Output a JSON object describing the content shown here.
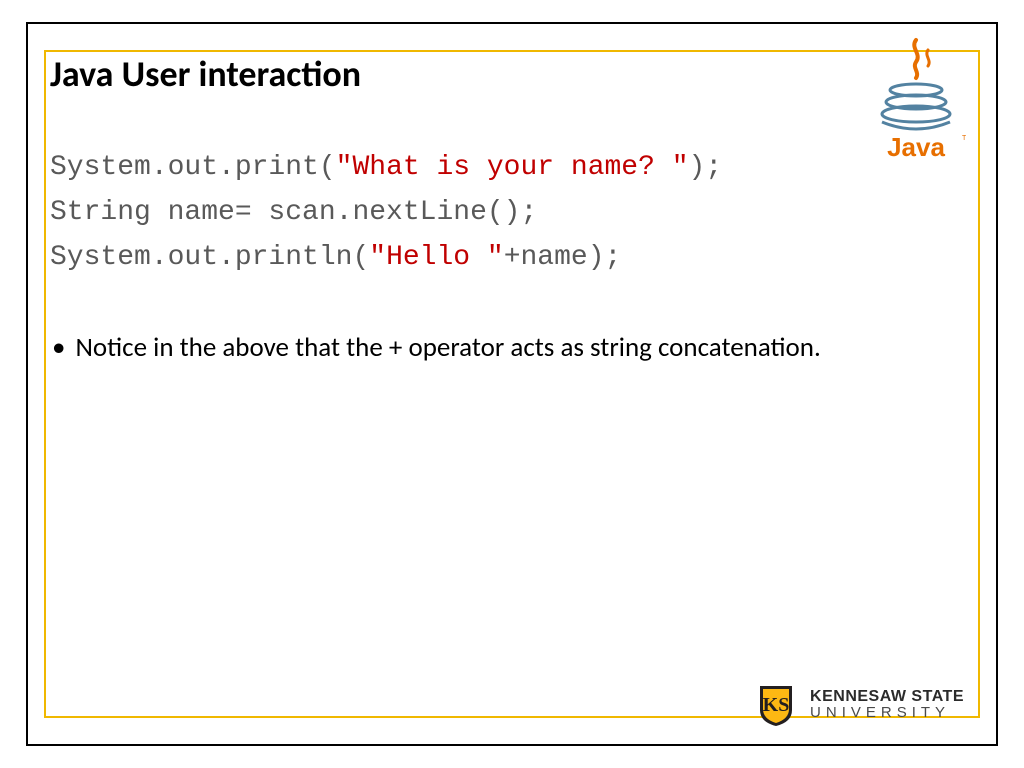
{
  "title": "Java User interaction",
  "code": {
    "l1a": "System.out.print(",
    "l1b": "\"What is your name? \"",
    "l1c": ");",
    "l2": "String name= scan.nextLine();",
    "l3a": "System.out.println(",
    "l3b": "\"Hello \"",
    "l3c": "+name);"
  },
  "bullet": "Notice in the above that the + operator acts as string concatenation.",
  "java_logo_text": "Java",
  "ksu": {
    "line1": "KENNESAW STATE",
    "line2": "UNIVERSITY"
  }
}
